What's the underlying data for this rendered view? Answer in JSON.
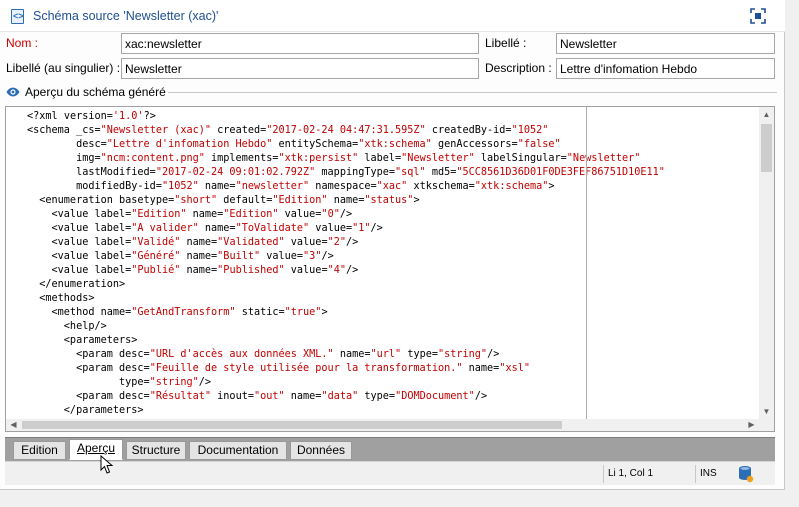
{
  "window": {
    "title": "Schéma source 'Newsletter (xac)'"
  },
  "form": {
    "nom_label": "Nom :",
    "nom_value": "xac:newsletter",
    "libelle_label": "Libellé :",
    "libelle_value": "Newsletter",
    "libelle_singulier_label": "Libellé (au singulier) :",
    "libelle_singulier_value": "Newsletter",
    "description_label": "Description :",
    "description_value": "Lettre d'infomation Hebdo"
  },
  "preview": {
    "section_title": "Aperçu du schéma généré",
    "code_lines": [
      [
        [
          "t",
          "<?"
        ],
        [
          "e",
          "xml "
        ],
        [
          "a",
          "version="
        ],
        [
          "s",
          "'1.0'"
        ],
        [
          "t",
          "?>"
        ]
      ],
      [
        [
          "t",
          "<schema "
        ],
        [
          "a",
          "_cs="
        ],
        [
          "s",
          "\"Newsletter (xac)\""
        ],
        [
          "a",
          " created="
        ],
        [
          "s",
          "\"2017-02-24 04:47:31.595Z\""
        ],
        [
          "a",
          " createdBy-id="
        ],
        [
          "s",
          "\"1052\""
        ]
      ],
      [
        [
          "a",
          "        desc="
        ],
        [
          "s",
          "\"Lettre d'infomation Hebdo\""
        ],
        [
          "a",
          " entitySchema="
        ],
        [
          "s",
          "\"xtk:schema\""
        ],
        [
          "a",
          " genAccessors="
        ],
        [
          "s",
          "\"false\""
        ]
      ],
      [
        [
          "a",
          "        img="
        ],
        [
          "s",
          "\"ncm:content.png\""
        ],
        [
          "a",
          " implements="
        ],
        [
          "s",
          "\"xtk:persist\""
        ],
        [
          "a",
          " label="
        ],
        [
          "s",
          "\"Newsletter\""
        ],
        [
          "a",
          " labelSingular="
        ],
        [
          "s",
          "\"Newsletter\""
        ]
      ],
      [
        [
          "a",
          "        lastModified="
        ],
        [
          "s",
          "\"2017-02-24 09:01:02.792Z\""
        ],
        [
          "a",
          " mappingType="
        ],
        [
          "s",
          "\"sql\""
        ],
        [
          "a",
          " md5="
        ],
        [
          "s",
          "\"5CC8561D36D01F0DE3FEF86751D10E11\""
        ]
      ],
      [
        [
          "a",
          "        modifiedBy-id="
        ],
        [
          "s",
          "\"1052\""
        ],
        [
          "a",
          " name="
        ],
        [
          "s",
          "\"newsletter\""
        ],
        [
          "a",
          " namespace="
        ],
        [
          "s",
          "\"xac\""
        ],
        [
          "a",
          " xtkschema="
        ],
        [
          "s",
          "\"xtk:schema\""
        ],
        [
          "t",
          ">"
        ]
      ],
      [
        [
          "t",
          "  <enumeration "
        ],
        [
          "a",
          "basetype="
        ],
        [
          "s",
          "\"short\""
        ],
        [
          "a",
          " default="
        ],
        [
          "s",
          "\"Edition\""
        ],
        [
          "a",
          " name="
        ],
        [
          "s",
          "\"status\""
        ],
        [
          "t",
          ">"
        ]
      ],
      [
        [
          "t",
          "    <value "
        ],
        [
          "a",
          "label="
        ],
        [
          "s",
          "\"Edition\""
        ],
        [
          "a",
          " name="
        ],
        [
          "s",
          "\"Edition\""
        ],
        [
          "a",
          " value="
        ],
        [
          "s",
          "\"0\""
        ],
        [
          "t",
          "/>"
        ]
      ],
      [
        [
          "t",
          "    <value "
        ],
        [
          "a",
          "label="
        ],
        [
          "s",
          "\"A valider\""
        ],
        [
          "a",
          " name="
        ],
        [
          "s",
          "\"ToValidate\""
        ],
        [
          "a",
          " value="
        ],
        [
          "s",
          "\"1\""
        ],
        [
          "t",
          "/>"
        ]
      ],
      [
        [
          "t",
          "    <value "
        ],
        [
          "a",
          "label="
        ],
        [
          "s",
          "\"Validé\""
        ],
        [
          "a",
          " name="
        ],
        [
          "s",
          "\"Validated\""
        ],
        [
          "a",
          " value="
        ],
        [
          "s",
          "\"2\""
        ],
        [
          "t",
          "/>"
        ]
      ],
      [
        [
          "t",
          "    <value "
        ],
        [
          "a",
          "label="
        ],
        [
          "s",
          "\"Généré\""
        ],
        [
          "a",
          " name="
        ],
        [
          "s",
          "\"Built\""
        ],
        [
          "a",
          " value="
        ],
        [
          "s",
          "\"3\""
        ],
        [
          "t",
          "/>"
        ]
      ],
      [
        [
          "t",
          "    <value "
        ],
        [
          "a",
          "label="
        ],
        [
          "s",
          "\"Publié\""
        ],
        [
          "a",
          " name="
        ],
        [
          "s",
          "\"Published\""
        ],
        [
          "a",
          " value="
        ],
        [
          "s",
          "\"4\""
        ],
        [
          "t",
          "/>"
        ]
      ],
      [
        [
          "t",
          "  </enumeration>"
        ]
      ],
      [
        [
          "t",
          "  <methods>"
        ]
      ],
      [
        [
          "t",
          "    <method "
        ],
        [
          "a",
          "name="
        ],
        [
          "s",
          "\"GetAndTransform\""
        ],
        [
          "a",
          " static="
        ],
        [
          "s",
          "\"true\""
        ],
        [
          "t",
          ">"
        ]
      ],
      [
        [
          "t",
          "      <help/>"
        ]
      ],
      [
        [
          "t",
          "      <parameters>"
        ]
      ],
      [
        [
          "t",
          "        <param "
        ],
        [
          "a",
          "desc="
        ],
        [
          "s",
          "\"URL d'accès aux données XML.\""
        ],
        [
          "a",
          " name="
        ],
        [
          "s",
          "\"url\""
        ],
        [
          "a",
          " type="
        ],
        [
          "s",
          "\"string\""
        ],
        [
          "t",
          "/>"
        ]
      ],
      [
        [
          "t",
          "        <param "
        ],
        [
          "a",
          "desc="
        ],
        [
          "s",
          "\"Feuille de style utilisée pour la transformation.\""
        ],
        [
          "a",
          " name="
        ],
        [
          "s",
          "\"xsl\""
        ]
      ],
      [
        [
          "a",
          "               type="
        ],
        [
          "s",
          "\"string\""
        ],
        [
          "t",
          "/>"
        ]
      ],
      [
        [
          "t",
          "        <param "
        ],
        [
          "a",
          "desc="
        ],
        [
          "s",
          "\"Résultat\""
        ],
        [
          "a",
          " inout="
        ],
        [
          "s",
          "\"out\""
        ],
        [
          "a",
          " name="
        ],
        [
          "s",
          "\"data\""
        ],
        [
          "a",
          " type="
        ],
        [
          "s",
          "\"DOMDocument\""
        ],
        [
          "t",
          "/>"
        ]
      ],
      [
        [
          "t",
          "      </parameters>"
        ]
      ]
    ],
    "colors": {
      "text": "#000000",
      "string": "#c00000"
    }
  },
  "tabs": [
    {
      "label": "Edition",
      "active": false
    },
    {
      "label": "Aperçu",
      "active": true
    },
    {
      "label": "Structure",
      "active": false
    },
    {
      "label": "Documentation",
      "active": false
    },
    {
      "label": "Données",
      "active": false
    }
  ],
  "status": {
    "position": "Li 1, Col 1",
    "mode": "INS",
    "db_icon": "database-icon"
  },
  "colors": {
    "title": "#1f4f94",
    "required_label": "#cc0000",
    "tab_strip": "#a0a0a0"
  }
}
